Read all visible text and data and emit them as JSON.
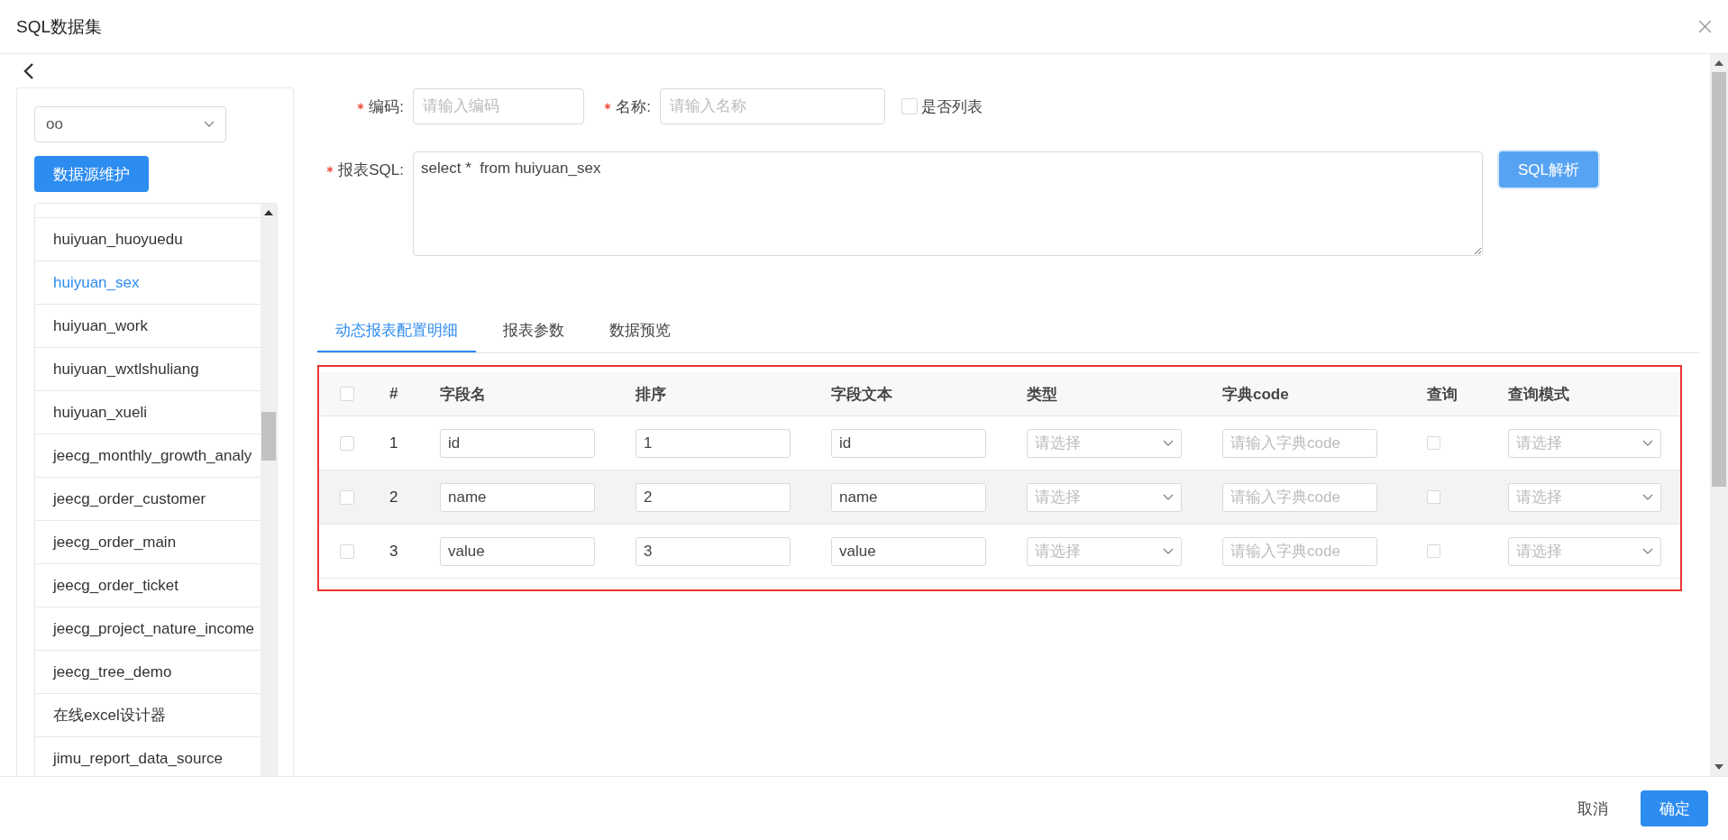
{
  "window": {
    "title": "SQL数据集"
  },
  "datasource": {
    "value": "oo",
    "button": "数据源维护"
  },
  "tables": [
    {
      "name": "huiyuan_huoyuedu",
      "selected": false
    },
    {
      "name": "huiyuan_sex",
      "selected": true
    },
    {
      "name": "huiyuan_work",
      "selected": false
    },
    {
      "name": "huiyuan_wxtlshuliang",
      "selected": false
    },
    {
      "name": "huiyuan_xueli",
      "selected": false
    },
    {
      "name": "jeecg_monthly_growth_analy",
      "selected": false
    },
    {
      "name": "jeecg_order_customer",
      "selected": false
    },
    {
      "name": "jeecg_order_main",
      "selected": false
    },
    {
      "name": "jeecg_order_ticket",
      "selected": false
    },
    {
      "name": "jeecg_project_nature_income",
      "selected": false
    },
    {
      "name": "jeecg_tree_demo",
      "selected": false
    },
    {
      "name": "在线excel设计器",
      "selected": false
    },
    {
      "name": "jimu_report_data_source",
      "selected": false
    }
  ],
  "form": {
    "code_required": true,
    "name_required": true,
    "sql_required": true,
    "code_label": "编码:",
    "code_placeholder": "请输入编码",
    "name_label": "名称:",
    "name_placeholder": "请输入名称",
    "is_list_label": "是否列表",
    "is_list": false,
    "sql_label": "报表SQL:",
    "sql": "select *  from huiyuan_sex",
    "parse_button": "SQL解析"
  },
  "tabs": [
    {
      "label": "动态报表配置明细",
      "selected": true
    },
    {
      "label": "报表参数",
      "selected": false
    },
    {
      "label": "数据预览",
      "selected": false
    }
  ],
  "table": {
    "select_all": false,
    "columns": [
      "#",
      "字段名",
      "排序",
      "字段文本",
      "类型",
      "字典code",
      "查询",
      "查询模式"
    ],
    "rows": [
      {
        "index": "1",
        "field": "id",
        "order": "1",
        "text": "id",
        "type_placeholder": "请选择",
        "dict_placeholder": "请输入字典code",
        "query": false,
        "mode_placeholder": "请选择",
        "checked": false,
        "highlighted": false
      },
      {
        "index": "2",
        "field": "name",
        "order": "2",
        "text": "name",
        "type_placeholder": "请选择",
        "dict_placeholder": "请输入字典code",
        "query": false,
        "mode_placeholder": "请选择",
        "checked": false,
        "highlighted": true
      },
      {
        "index": "3",
        "field": "value",
        "order": "3",
        "text": "value",
        "type_placeholder": "请选择",
        "dict_placeholder": "请输入字典code",
        "query": false,
        "mode_placeholder": "请选择",
        "checked": false,
        "highlighted": false
      }
    ]
  },
  "footer": {
    "cancel": "取消",
    "ok": "确定"
  }
}
